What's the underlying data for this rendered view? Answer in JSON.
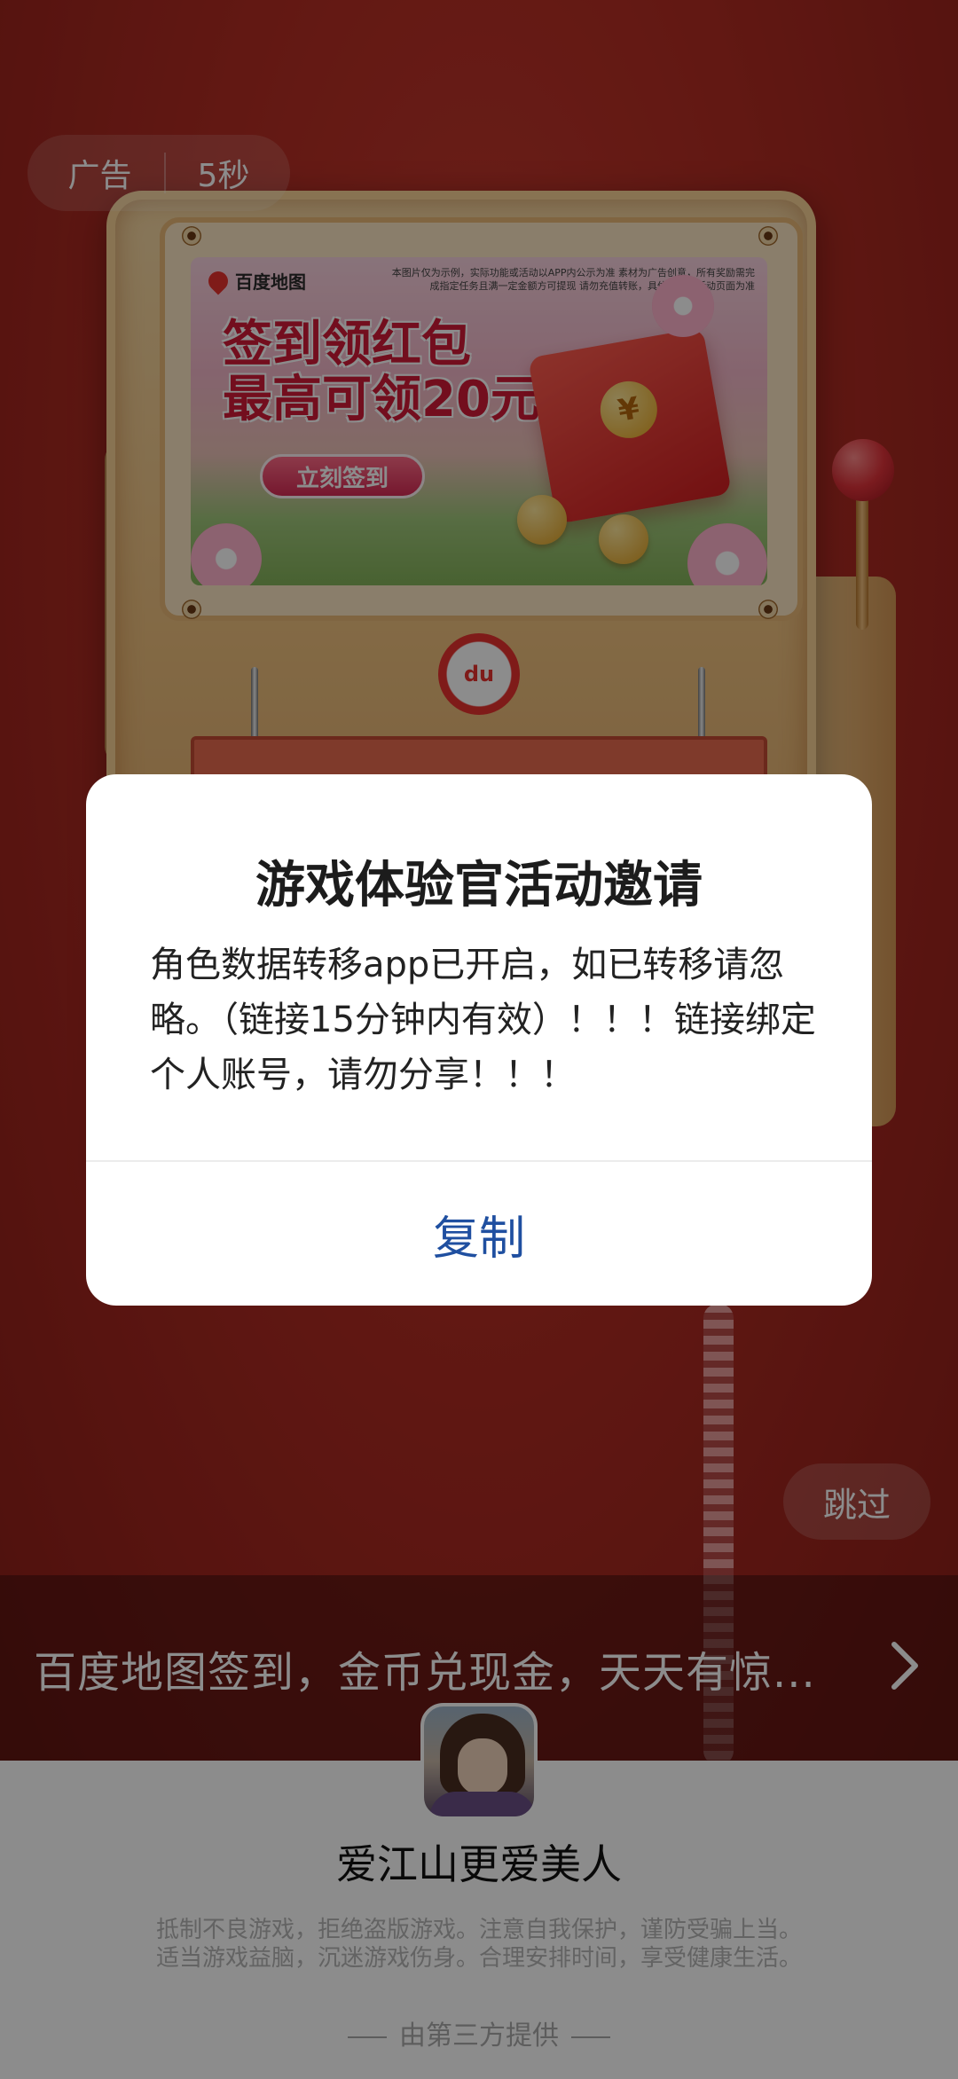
{
  "ad": {
    "label": "广告",
    "countdown": "5秒",
    "skip_label": "跳过",
    "creative": {
      "brand": "百度地图",
      "disclaimer": "本图片仅为示例，实际功能或活动以APP内公示为准 素材为广告创意，所有奖励需完成指定任务且满一定金额方可提现 请勿充值转账，具体规则以活动页面为准",
      "headline_line1": "签到领红包",
      "headline_line2": "最高可领20元",
      "cta": "立刻签到",
      "badge": "du"
    },
    "banner_text": "百度地图签到，金币兑现金，天天有惊..."
  },
  "app": {
    "name": "爱江山更爱美人",
    "notice_line1": "抵制不良游戏，拒绝盗版游戏。注意自我保护，谨防受骗上当。",
    "notice_line2": "适当游戏益脑，沉迷游戏伤身。合理安排时间，享受健康生活。",
    "provider": "由第三方提供"
  },
  "dialog": {
    "title": "游戏体验官活动邀请",
    "message": "角色数据转移app已开启，如已转移请忽略。（链接15分钟内有效）！！！链接绑定个人账号，请勿分享！！！",
    "button": "复制"
  },
  "colors": {
    "dialog_button": "#1f4fa0",
    "ad_background": "#b22c23",
    "headline": "#d21b37"
  },
  "icons": {
    "chevron": "chevron-right-icon",
    "pin": "map-pin-icon"
  }
}
